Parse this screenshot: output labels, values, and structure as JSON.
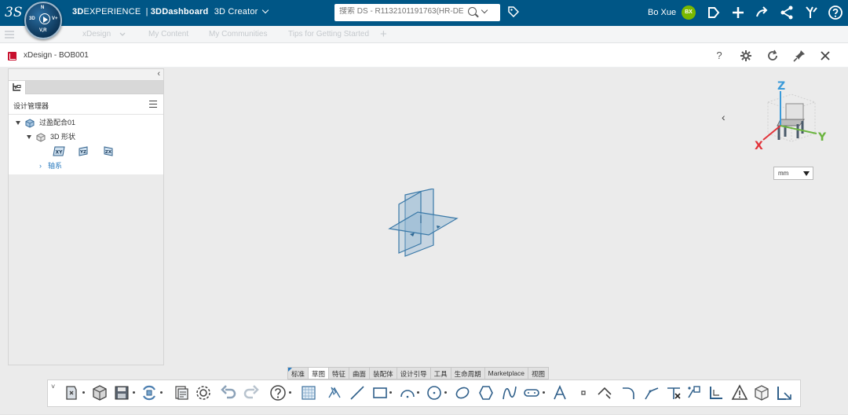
{
  "topbar": {
    "logo_text": "3S",
    "compass": {
      "top": "3D",
      "left": "3D",
      "right": "V+",
      "bottom": "V,R",
      "north": "N"
    },
    "brand_3dexperience_bold": "3D",
    "brand_3dexperience_rest": "EXPERIENCE",
    "brand_separator": "|",
    "brand_dashboard_bold": "3D",
    "brand_dashboard_rest": "Dashboard",
    "app_name": "3D Creator",
    "search_placeholder": "搜索 DS - R1132101191763(HR-DEM",
    "user_name": "Bo Xue",
    "user_initials": "BX",
    "accent_color": "#005686",
    "avatar_color": "#7ab800"
  },
  "dashboard_tabs": {
    "tabs": [
      "xDesign",
      "My Content",
      "My Communities",
      "Tips for Getting Started"
    ],
    "add": "+"
  },
  "widget": {
    "title": "xDesign - BOB001",
    "help": "?",
    "icons": [
      "help-icon",
      "settings-icon",
      "refresh-icon",
      "pin-icon",
      "close-icon"
    ]
  },
  "design_manager": {
    "title": "设计管理器",
    "collapse": "‹",
    "tree": {
      "root": "过盈配合01",
      "shape": "3D 形状",
      "planes": [
        "XY",
        "YZ",
        "ZX"
      ],
      "axes": "轴系"
    }
  },
  "viewport": {
    "collapse": "‹",
    "unit": "mm",
    "axis_labels": {
      "z": "Z",
      "x": "X",
      "y": "Y"
    },
    "axis_colors": {
      "z": "#3a9ad9",
      "x": "#e2333a",
      "y": "#6ab43e"
    }
  },
  "toolbar": {
    "tabs": [
      "标准",
      "草图",
      "特征",
      "曲面",
      "装配体",
      "设计引导",
      "工具",
      "生命周期",
      "Marketplace",
      "视图"
    ],
    "active_tab": "草图",
    "menu_chevron": "˅"
  }
}
